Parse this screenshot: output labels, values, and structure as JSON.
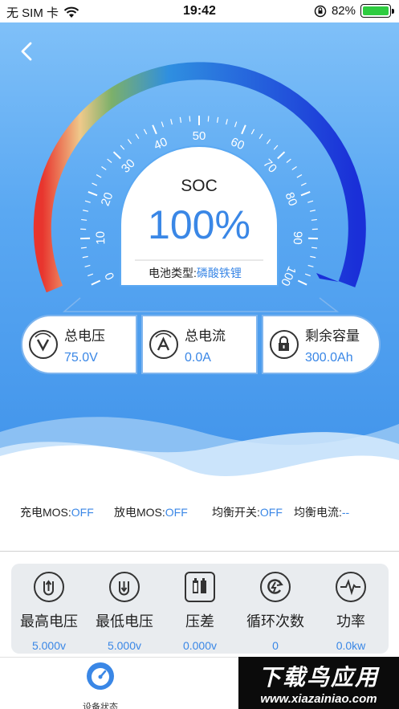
{
  "status_bar": {
    "carrier": "无 SIM 卡",
    "time": "19:42",
    "battery_percent": "82%"
  },
  "gauge": {
    "title": "SOC",
    "value": "100%",
    "ticks": [
      "0",
      "10",
      "20",
      "30",
      "40",
      "50",
      "60",
      "70",
      "80",
      "90",
      "100"
    ],
    "battery_type_label": "电池类型:",
    "battery_type_value": "磷酸铁锂"
  },
  "info": [
    {
      "label": "总电压",
      "value": "75.0V",
      "icon": "voltage-v-icon"
    },
    {
      "label": "总电流",
      "value": "0.0A",
      "icon": "current-a-icon"
    },
    {
      "label": "剩余容量",
      "value": "300.0Ah",
      "icon": "capacity-lock-icon"
    }
  ],
  "flags": [
    {
      "label": "充电MOS:",
      "value": "OFF"
    },
    {
      "label": "放电MOS:",
      "value": "OFF"
    },
    {
      "label": "均衡开关:",
      "value": "OFF"
    },
    {
      "label": "均衡电流:",
      "value": "--"
    }
  ],
  "stats": [
    {
      "label": "最高电压",
      "value": "5.000v",
      "icon": "max-voltage-icon"
    },
    {
      "label": "最低电压",
      "value": "5.000v",
      "icon": "min-voltage-icon"
    },
    {
      "label": "压差",
      "value": "0.000v",
      "icon": "voltage-diff-icon"
    },
    {
      "label": "循环次数",
      "value": "0",
      "icon": "cycle-icon"
    },
    {
      "label": "功率",
      "value": "0.0kw",
      "icon": "power-icon"
    }
  ],
  "tabbar": {
    "active_tab": "设备状态"
  },
  "watermark": {
    "title": "下载鸟应用",
    "url": "www.xiazainiao.com"
  },
  "colors": {
    "accent": "#3a87e6",
    "hero_top": "#7fc0f8",
    "hero_bottom": "#3f92ea"
  }
}
